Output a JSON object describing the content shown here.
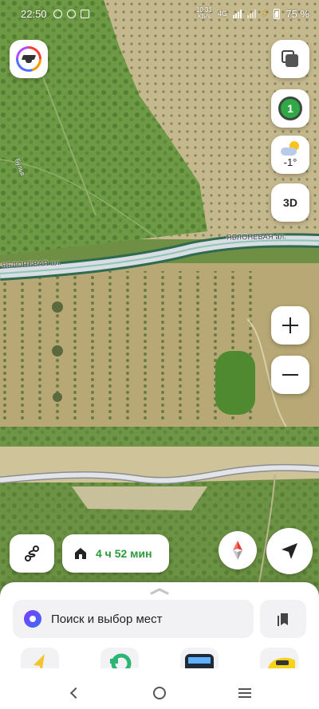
{
  "status_bar": {
    "time": "22:50",
    "net_speed_value": "10,31",
    "net_speed_unit": "КБ/s",
    "network": "4G",
    "battery": "75 %"
  },
  "map": {
    "street_label_1": "ЯБЛОНЕВАЯ ал.",
    "street_label_2": "ЯБЛОНЕВАЯ ал.",
    "path_label": "Бульв",
    "colors": {
      "forest": "#5f8a3a",
      "field": "#b9a877",
      "road": "#d9dde4",
      "road_edge": "#2f6b4f"
    }
  },
  "controls": {
    "profile_icon": "graduation-cap-icon",
    "layers_icon": "layers-icon",
    "traffic_level": "1",
    "weather_temp": "-1°",
    "mode_3d": "3D",
    "zoom_in_icon": "plus-icon",
    "zoom_out_icon": "minus-icon",
    "route_icon": "route-icon",
    "home_eta": "4 ч 52 мин",
    "compass_icon": "compass-icon",
    "locate_icon": "locate-arrow-icon"
  },
  "sheet": {
    "search_label": "Поиск и выбор мест",
    "bookmarks_icon": "bookmarks-icon",
    "shortcuts": [
      "navigator-icon",
      "transport-icon",
      "metro-icon",
      "taxi-icon"
    ]
  },
  "nav_bar": {
    "back_icon": "back-icon",
    "home_icon": "home-circle-icon",
    "recents_icon": "menu-lines-icon"
  }
}
